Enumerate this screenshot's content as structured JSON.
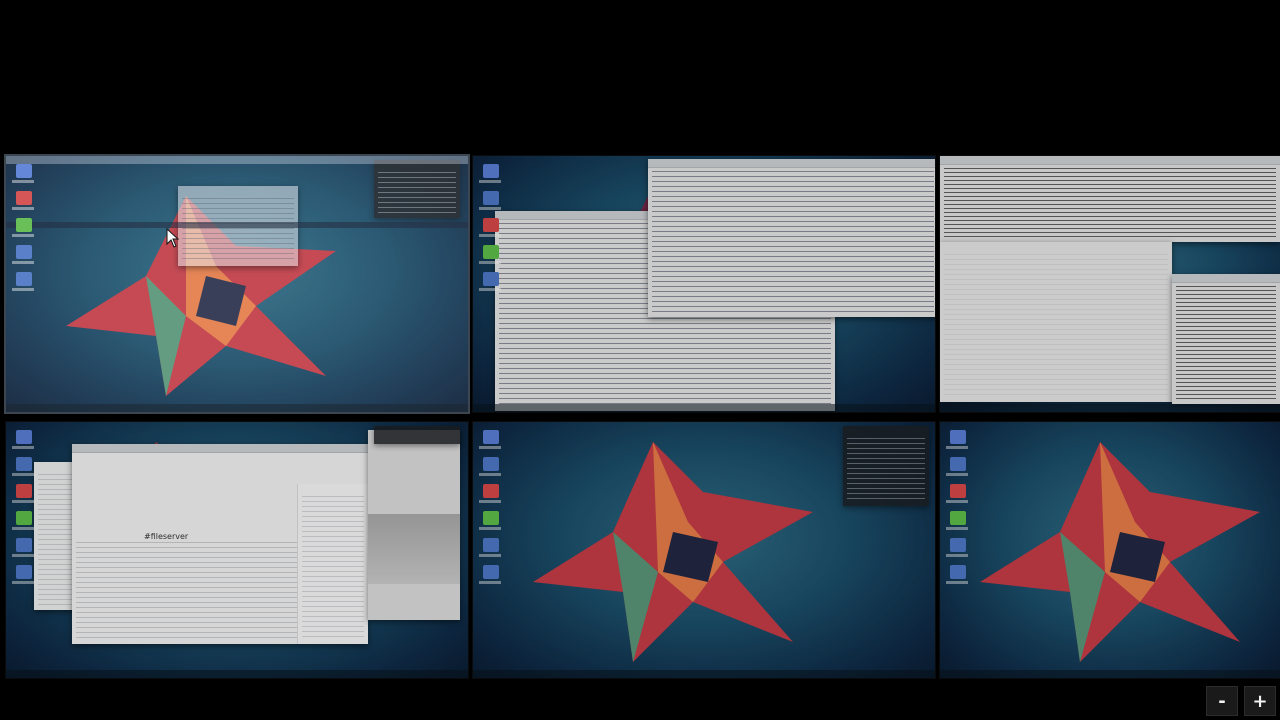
{
  "workspace_switcher": {
    "workspaces": [
      {
        "index": 1,
        "current": true
      },
      {
        "index": 2,
        "current": false
      },
      {
        "index": 3,
        "current": false
      },
      {
        "index": 4,
        "current": false,
        "window_heading": "#fileserver"
      },
      {
        "index": 5,
        "current": false
      },
      {
        "index": 6,
        "current": false
      }
    ]
  },
  "zoom": {
    "out_label": "-",
    "in_label": "+"
  },
  "colors": {
    "background": "#000000",
    "wallpaper_top": "#2f6f86",
    "wallpaper_bottom": "#0b1c33",
    "star_red": "#e0413b",
    "star_orange": "#f08a3c",
    "star_green": "#3fb58a"
  },
  "icons": {
    "desktop_icon": "app-icon",
    "cursor": "mouse-pointer-icon"
  }
}
